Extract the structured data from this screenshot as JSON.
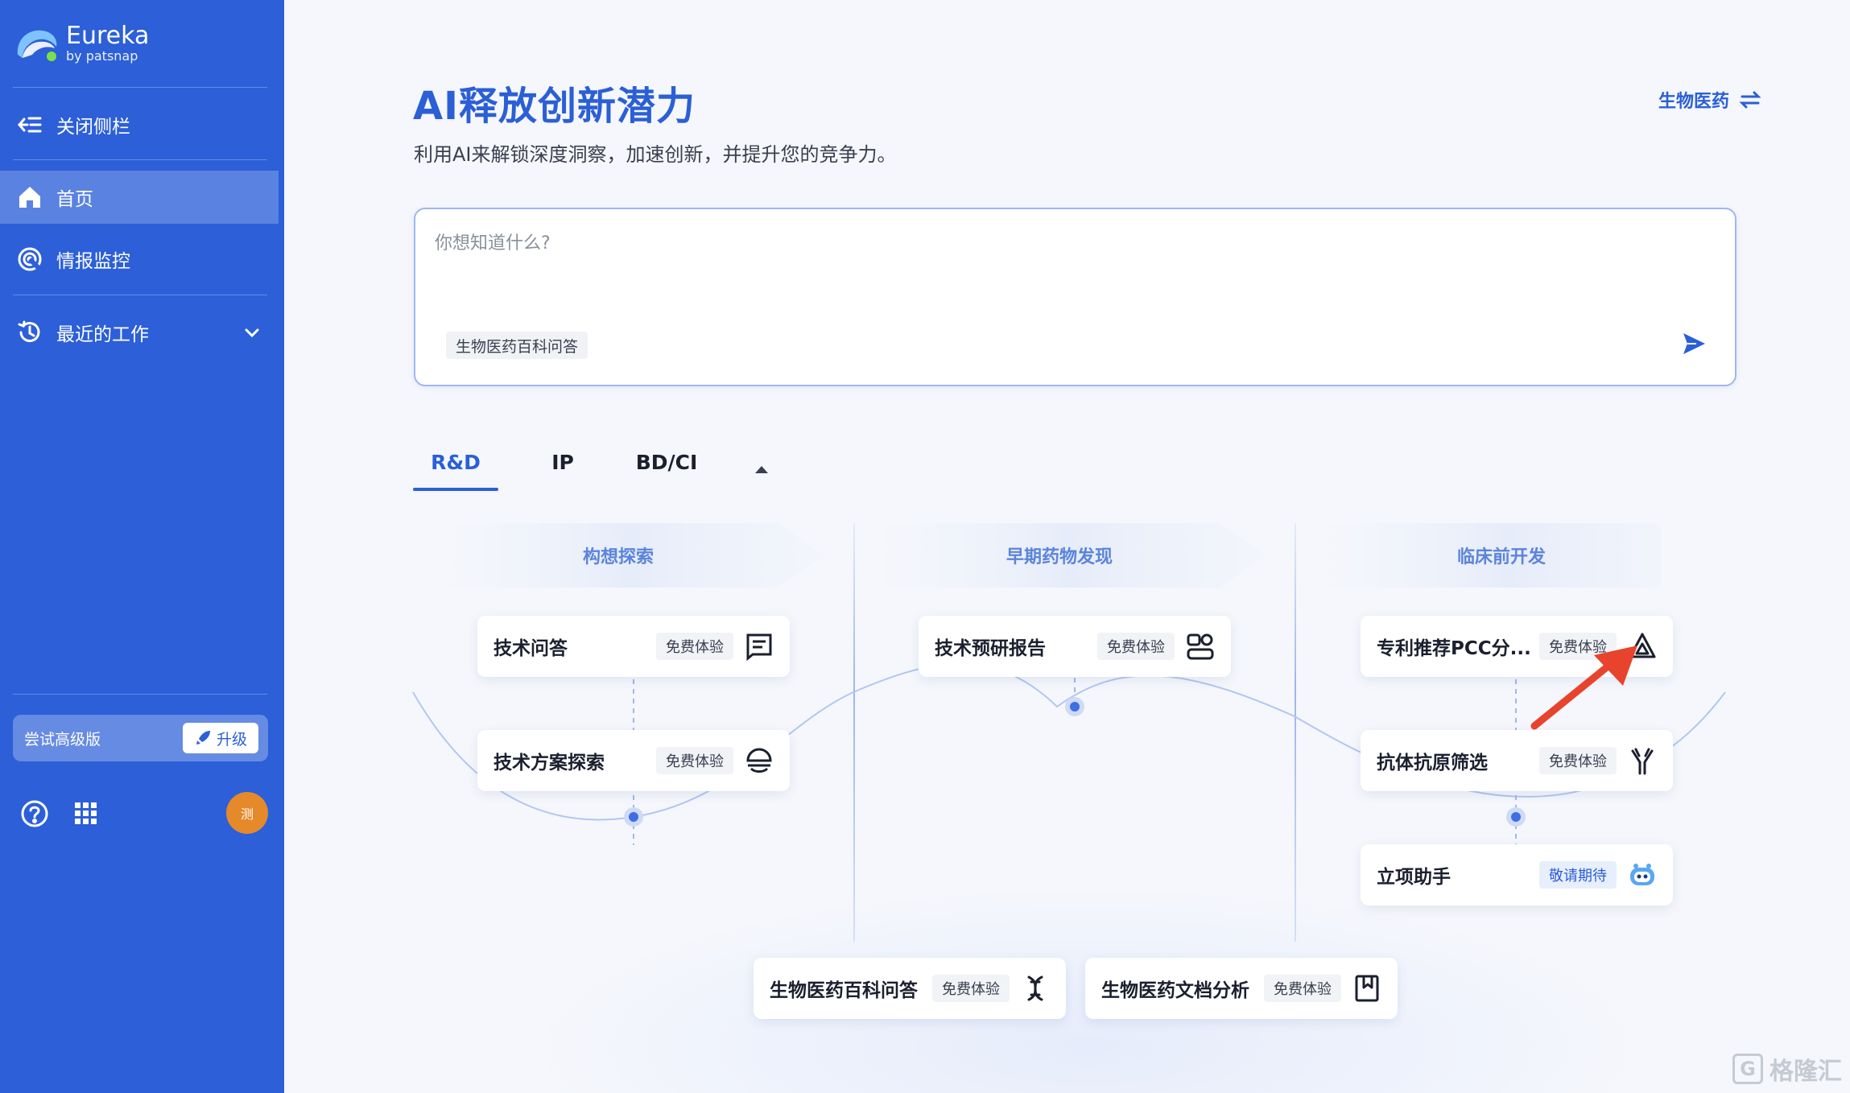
{
  "app": {
    "logo_name": "Eureka",
    "logo_sub": "by patsnap"
  },
  "sidebar": {
    "close_label": "关闭侧栏",
    "items": [
      {
        "label": "首页",
        "icon": "home-icon",
        "active": true
      },
      {
        "label": "情报监控",
        "icon": "radar-icon",
        "active": false
      },
      {
        "label": "最近的工作",
        "icon": "history-icon",
        "active": false
      }
    ],
    "trial_label": "尝试高级版",
    "upgrade_label": "升级",
    "avatar_text": "测"
  },
  "hero": {
    "title": "AI释放创新潜力",
    "subtitle": "利用AI来解锁深度洞察，加速创新，并提升您的竞争力。",
    "domain_label": "生物医药"
  },
  "ask": {
    "placeholder": "你想知道什么?",
    "tag": "生物医药百科问答"
  },
  "tabs": [
    "R&D",
    "IP",
    "BD/CI"
  ],
  "phases": [
    "构想探索",
    "早期药物发现",
    "临床前开发"
  ],
  "cards": [
    {
      "title": "技术问答",
      "badge": "免费体验",
      "icon": "message-icon"
    },
    {
      "title": "技术方案探索",
      "badge": "免费体验",
      "icon": "solution-icon"
    },
    {
      "title": "技术预研报告",
      "badge": "免费体验",
      "icon": "report-icon"
    },
    {
      "title": "专利推荐PCC分...",
      "badge": "免费体验",
      "icon": "molecule-icon"
    },
    {
      "title": "抗体抗原筛选",
      "badge": "免费体验",
      "icon": "antibody-icon"
    },
    {
      "title": "立项助手",
      "badge": "敬请期待",
      "icon": "robot-icon"
    },
    {
      "title": "生物医药百科问答",
      "badge": "免费体验",
      "icon": "dna-icon"
    },
    {
      "title": "生物医药文档分析",
      "badge": "免费体验",
      "icon": "bookmark-icon"
    }
  ],
  "colors": {
    "sidebar_bg": "#2c5fd8",
    "accent": "#2b5fd6",
    "annotation_arrow": "#e8432d"
  },
  "footer_watermark": "格隆汇"
}
